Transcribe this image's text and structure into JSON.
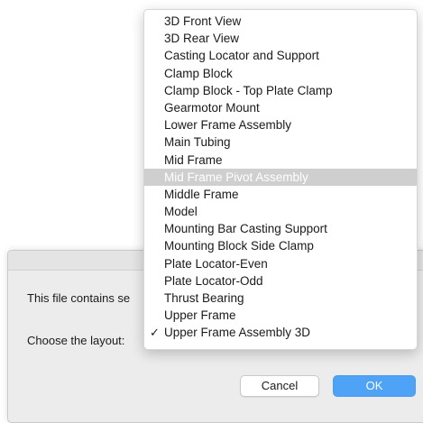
{
  "dialog": {
    "message_truncated": "This file contains se",
    "layout_label": "Choose the layout:",
    "cancel_label": "Cancel",
    "ok_label": "OK"
  },
  "menu": {
    "items": [
      {
        "label": "3D Front View"
      },
      {
        "label": "3D Rear View"
      },
      {
        "label": "Casting Locator and Support"
      },
      {
        "label": "Clamp Block"
      },
      {
        "label": "Clamp Block - Top Plate Clamp"
      },
      {
        "label": "Gearmotor Mount"
      },
      {
        "label": "Lower Frame Assembly"
      },
      {
        "label": "Main Tubing"
      },
      {
        "label": "Mid Frame"
      },
      {
        "label": "Mid Frame Pivot Assembly",
        "highlighted": true
      },
      {
        "label": "Middle Frame"
      },
      {
        "label": "Model"
      },
      {
        "label": "Mounting Bar Casting Support"
      },
      {
        "label": "Mounting Block Side Clamp"
      },
      {
        "label": "Plate Locator-Even"
      },
      {
        "label": "Plate Locator-Odd"
      },
      {
        "label": "Thrust Bearing"
      },
      {
        "label": "Upper Frame"
      },
      {
        "label": "Upper Frame Assembly 3D",
        "checked": true
      }
    ],
    "check_glyph": "✓"
  },
  "colors": {
    "highlight": "#cfcfcf",
    "ok_button": "#4fa3f7",
    "dialog_bg": "#ececec"
  }
}
